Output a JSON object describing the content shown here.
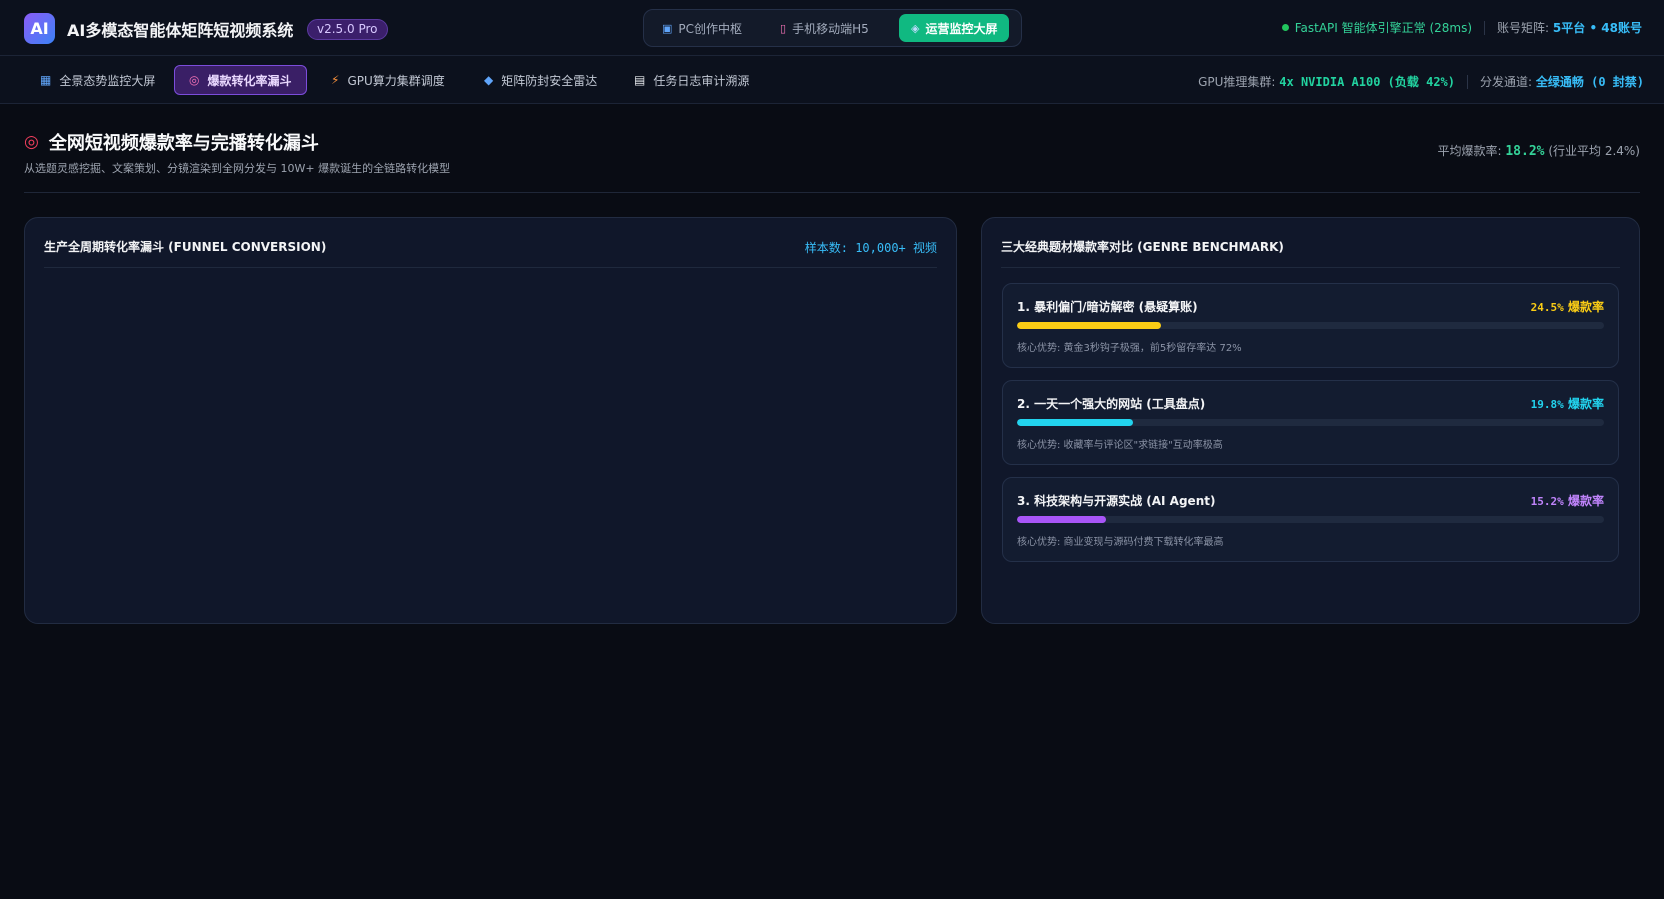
{
  "header": {
    "logo_text": "AI",
    "app_title": "AI多模态智能体矩阵短视频系统",
    "version": "v2.5.0 Pro",
    "modes": [
      {
        "icon": "monitor-icon",
        "glyph": "▣",
        "label": "PC创作中枢",
        "active": false
      },
      {
        "icon": "phone-icon",
        "glyph": "▯",
        "label": "手机移动端H5",
        "active": false
      },
      {
        "icon": "shield-icon",
        "glyph": "◈",
        "label": "运营监控大屏",
        "active": true
      }
    ],
    "engine_status": "FastAPI 智能体引擎正常 (28ms)",
    "account_label": "账号矩阵:",
    "account_value": "5平台 • 48账号"
  },
  "subnav": {
    "items": [
      {
        "icon": "bar-chart-icon",
        "glyph": "▦",
        "label": "全景态势监控大屏",
        "active": false
      },
      {
        "icon": "target-icon",
        "glyph": "◎",
        "label": "爆款转化率漏斗",
        "active": true
      },
      {
        "icon": "bolt-icon",
        "glyph": "⚡",
        "label": "GPU算力集群调度",
        "active": false
      },
      {
        "icon": "shield-icon",
        "glyph": "◆",
        "label": "矩阵防封安全雷达",
        "active": false
      },
      {
        "icon": "document-icon",
        "glyph": "▤",
        "label": "任务日志审计溯源",
        "active": false
      }
    ],
    "gpu_label": "GPU推理集群:",
    "gpu_value": "4x NVIDIA A100 (负载 42%)",
    "channel_label": "分发通道:",
    "channel_value": "全绿通畅 (0 封禁)"
  },
  "page": {
    "title": "全网短视频爆款率与完播转化漏斗",
    "subtitle": "从选题灵感挖掘、文案策划、分镜渲染到全网分发与 10W+ 爆款诞生的全链路转化模型",
    "avg_label": "平均爆款率:",
    "avg_value": "18.2%",
    "avg_industry": "(行业平均 2.4%)"
  },
  "funnel_panel": {
    "title": "生产全周期转化率漏斗 (FUNNEL CONVERSION)",
    "sample": "样本数: 10,000+ 视频"
  },
  "genre_panel": {
    "title": "三大经典题材爆款率对比 (GENRE BENCHMARK)",
    "rate_suffix": "爆款率",
    "items": [
      {
        "name": "1. 暴利偏门/暗访解密 (悬疑算账)",
        "rate_text": "24.5%",
        "rate": 24.5,
        "color": "#facc15",
        "note": "核心优势: 黄金3秒钩子极强，前5秒留存率达 72%"
      },
      {
        "name": "2. 一天一个强大的网站 (工具盘点)",
        "rate_text": "19.8%",
        "rate": 19.8,
        "color": "#22d3ee",
        "note": "核心优势: 收藏率与评论区\"求链接\"互动率极高"
      },
      {
        "name": "3. 科技架构与开源实战 (AI Agent)",
        "rate_text": "15.2%",
        "rate": 15.2,
        "color": "#a855f7",
        "note": "核心优势: 商业变现与源码付费下载转化率最高"
      }
    ]
  }
}
